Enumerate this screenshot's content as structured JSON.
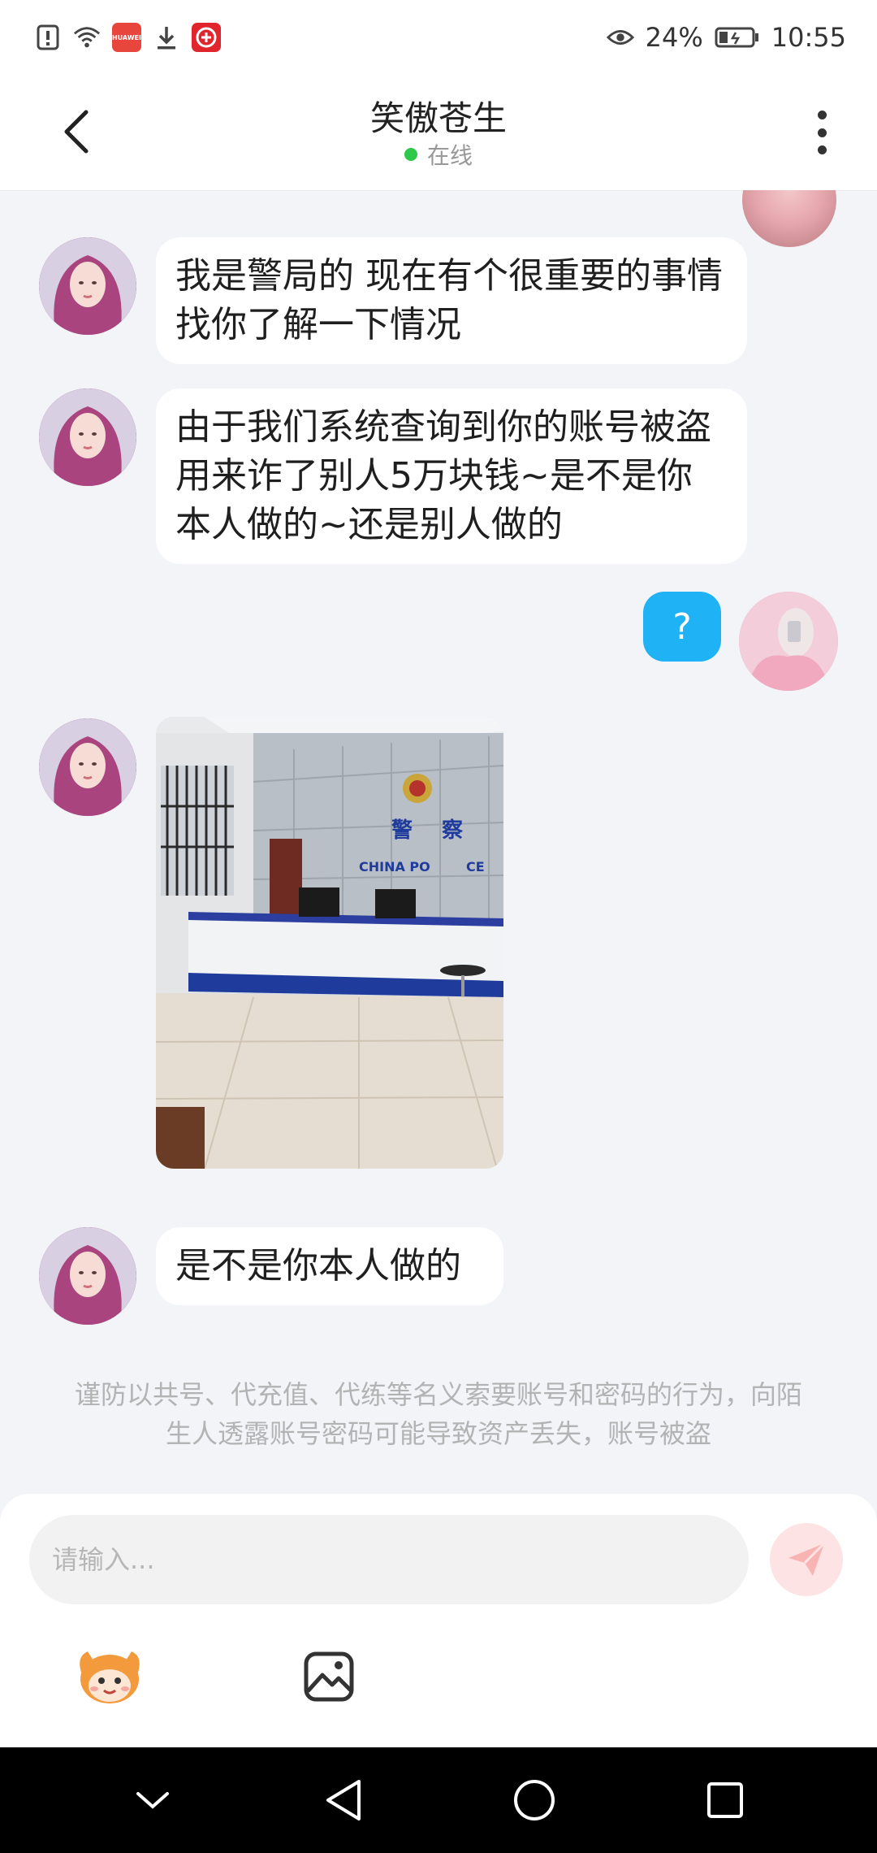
{
  "status_bar": {
    "battery": "24%",
    "time": "10:55",
    "app_icons": [
      "alert-icon",
      "wifi-icon",
      "huawei-store-icon",
      "download-icon",
      "app-icon"
    ],
    "huawei_label": "HUAWEI"
  },
  "header": {
    "title": "笑傲苍生",
    "status": "在线"
  },
  "messages": [
    {
      "from": "other",
      "type": "text",
      "text": "我是警局的 现在有个很重要的事情找你了解一下情况"
    },
    {
      "from": "other",
      "type": "text",
      "text": "由于我们系统查询到你的账号被盗用来诈了别人5万块钱~是不是你本人做的~还是别人做的"
    },
    {
      "from": "self",
      "type": "text",
      "text": "?"
    },
    {
      "from": "other",
      "type": "image",
      "image_text": [
        "警",
        "察",
        "CHINA PO",
        "CE"
      ]
    },
    {
      "from": "other",
      "type": "text",
      "text": "是不是你本人做的"
    }
  ],
  "notice": "谨防以共号、代充值、代练等名义索要账号和密码的行为，向陌生人透露账号密码可能导致资产丢失，账号被盗",
  "input": {
    "placeholder": "请输入..."
  },
  "colors": {
    "self_bubble": "#1fb3f6",
    "online_dot": "#2ec84a",
    "send_button": "#fde3e3",
    "send_icon": "#f8b3b3"
  }
}
